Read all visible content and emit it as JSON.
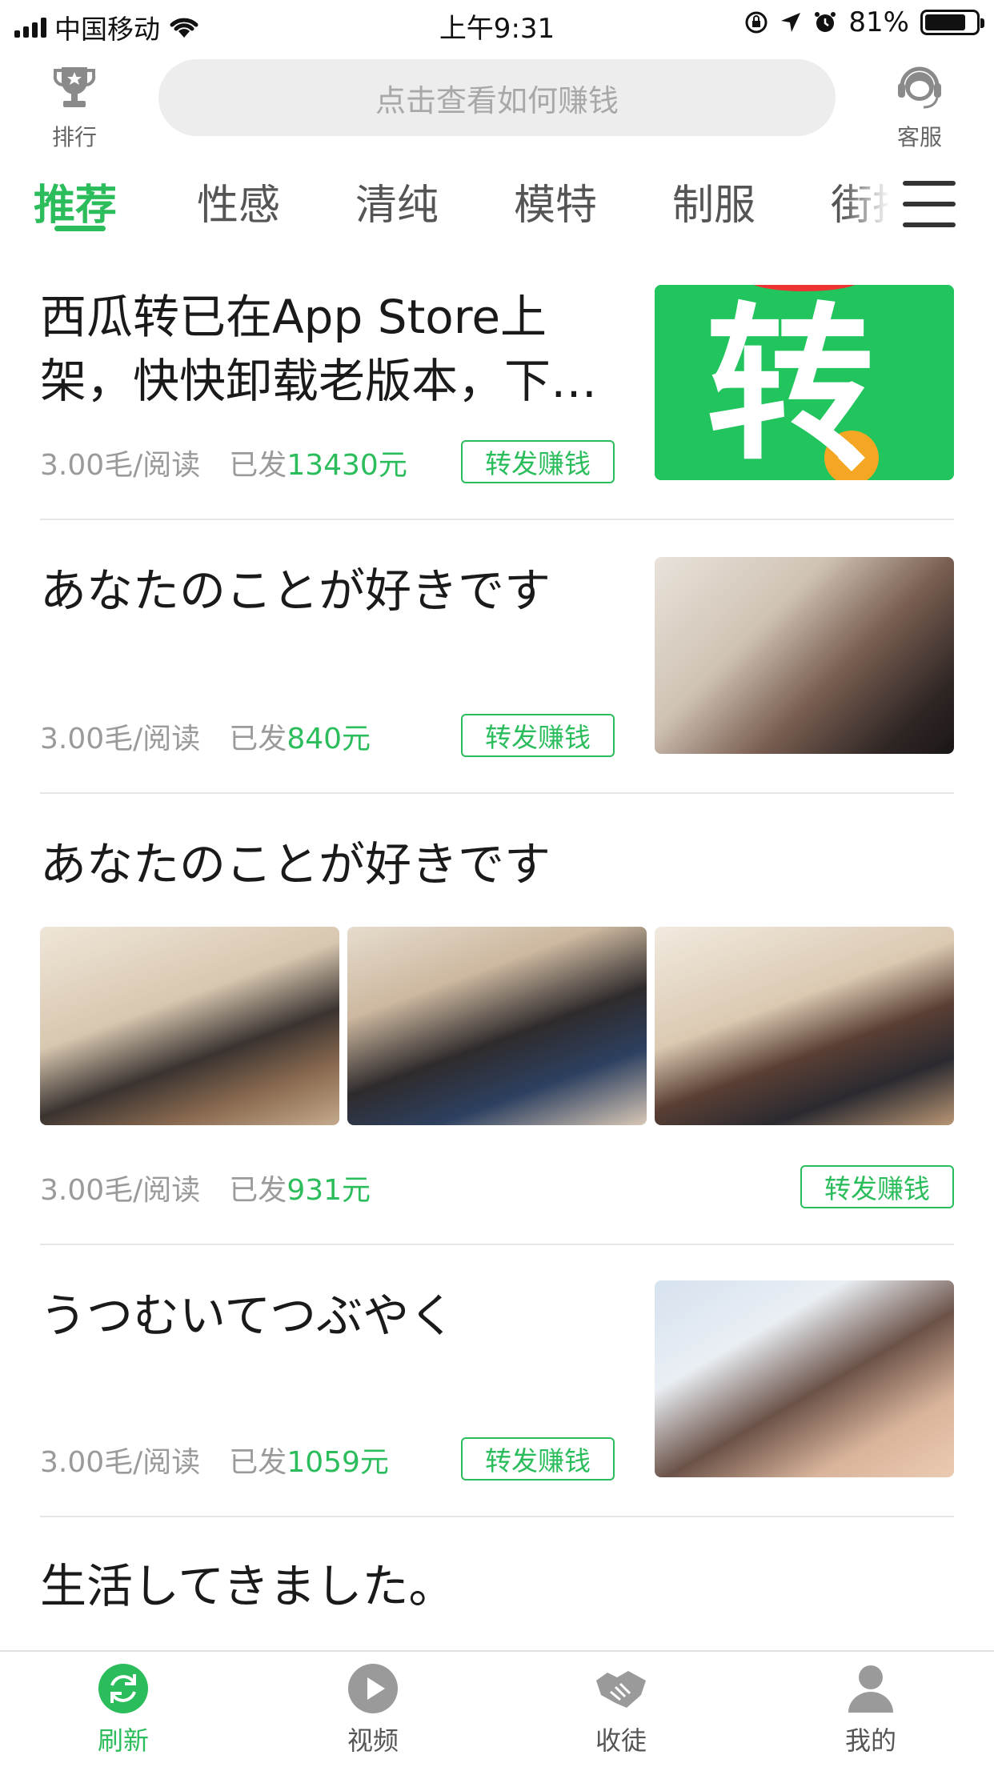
{
  "status_bar": {
    "carrier": "中国移动",
    "time": "上午9:31",
    "battery_percent": "81%",
    "battery_level": 0.81,
    "icons": [
      "signal-icon",
      "wifi-icon",
      "orientation-lock-icon",
      "location-icon",
      "alarm-icon",
      "battery-icon"
    ]
  },
  "header": {
    "rank_label": "排行",
    "rank_icon": "trophy-icon",
    "search_placeholder": "点击查看如何赚钱",
    "service_label": "客服",
    "service_icon": "headset-icon"
  },
  "tabs": [
    {
      "label": "推荐",
      "active": true
    },
    {
      "label": "性感",
      "active": false
    },
    {
      "label": "清纯",
      "active": false
    },
    {
      "label": "模特",
      "active": false
    },
    {
      "label": "制服",
      "active": false
    },
    {
      "label": "街拍",
      "active": false
    }
  ],
  "articles": [
    {
      "title": "西瓜转已在App Store上架，快快卸载老版本，下…",
      "rate": "3.00毛/阅读",
      "sent_prefix": "已发",
      "sent_amount": "13430元",
      "share_label": "转发赚钱",
      "thumb_text": "转"
    },
    {
      "title": "あなたのことが好きです",
      "rate": "3.00毛/阅读",
      "sent_prefix": "已发",
      "sent_amount": "840元",
      "share_label": "转发赚钱"
    },
    {
      "title": "あなたのことが好きです",
      "rate": "3.00毛/阅读",
      "sent_prefix": "已发",
      "sent_amount": "931元",
      "share_label": "转发赚钱"
    },
    {
      "title": "うつむいてつぶやく",
      "rate": "3.00毛/阅读",
      "sent_prefix": "已发",
      "sent_amount": "1059元",
      "share_label": "转发赚钱"
    },
    {
      "title": "生活してきました。"
    }
  ],
  "tabbar": [
    {
      "label": "刷新",
      "icon": "refresh-icon",
      "active": true
    },
    {
      "label": "视频",
      "icon": "play-icon",
      "active": false
    },
    {
      "label": "收徒",
      "icon": "handshake-icon",
      "active": false
    },
    {
      "label": "我的",
      "icon": "person-icon",
      "active": false
    }
  ],
  "colors": {
    "accent": "#2bbd5b",
    "meta_gray": "#9a9a9a",
    "search_bg": "#ededed"
  }
}
